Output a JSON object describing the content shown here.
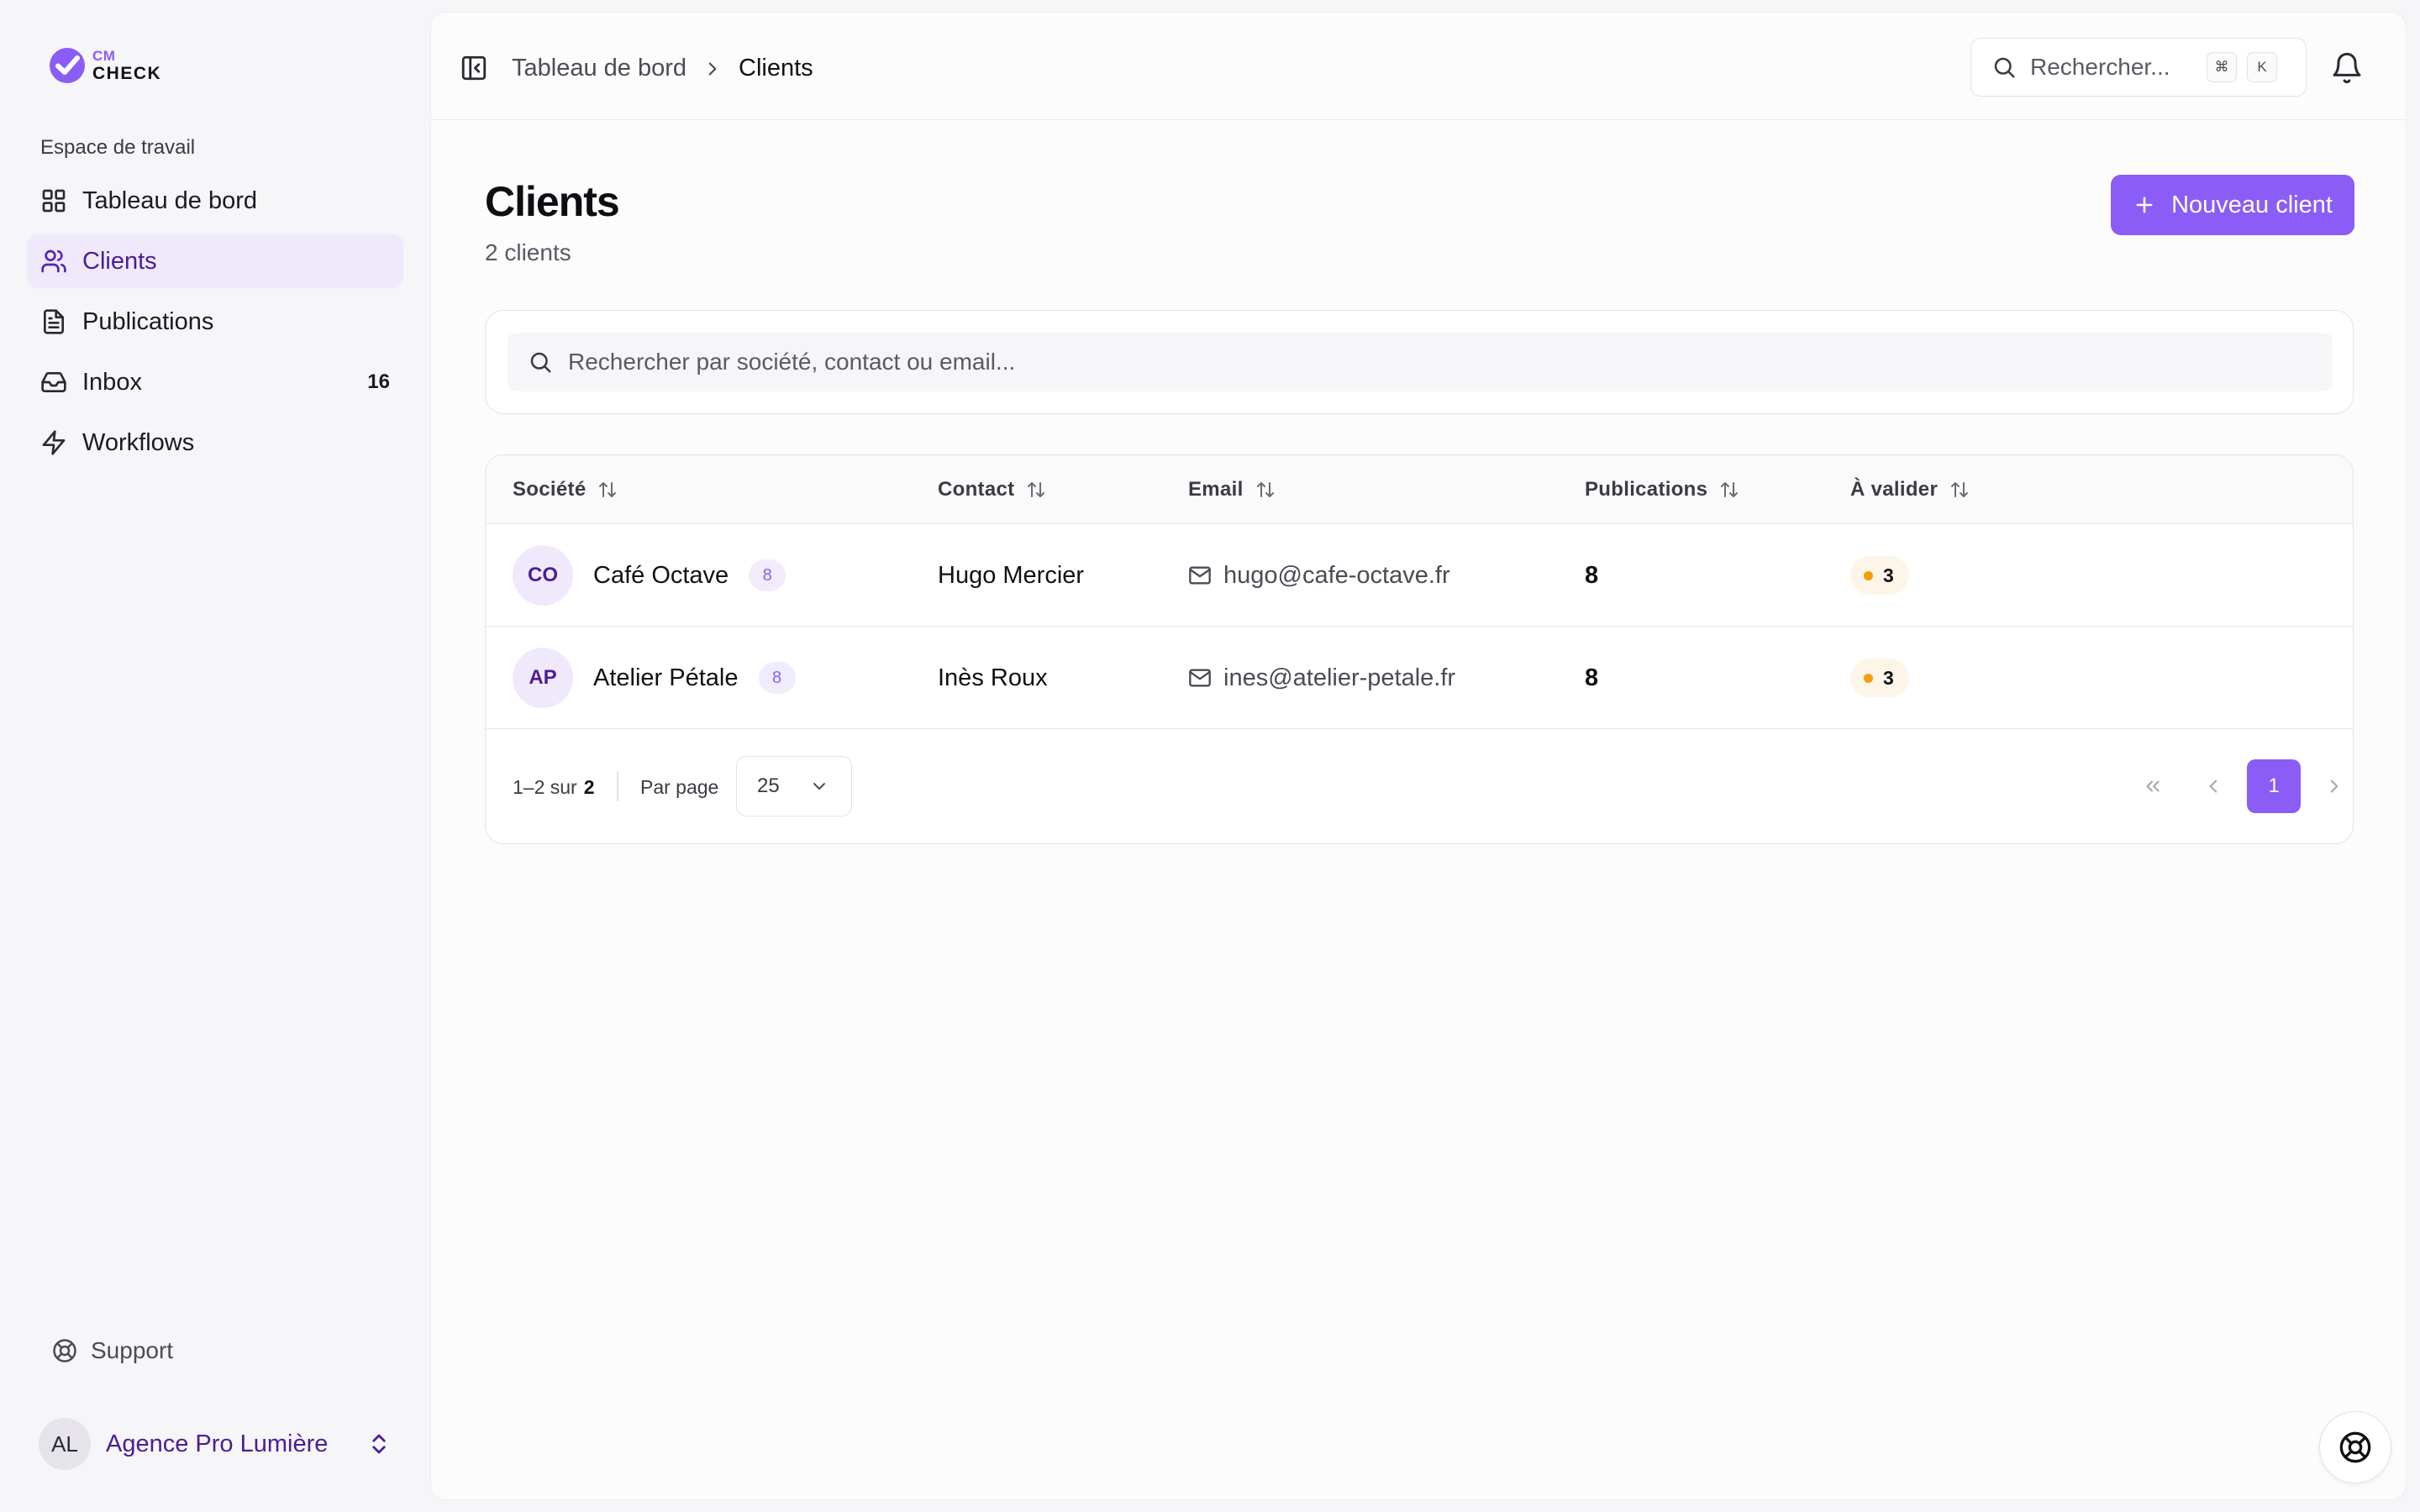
{
  "brand": {
    "logo_top": "CM",
    "logo_bottom": "CHECK",
    "accent_color": "#8b5cf6"
  },
  "sidebar": {
    "section_label": "Espace de travail",
    "items": [
      {
        "label": "Tableau de bord",
        "icon": "layout-grid-icon",
        "active": false
      },
      {
        "label": "Clients",
        "icon": "users-icon",
        "active": true
      },
      {
        "label": "Publications",
        "icon": "file-text-icon",
        "active": false
      },
      {
        "label": "Inbox",
        "icon": "inbox-icon",
        "active": false,
        "badge": "16"
      },
      {
        "label": "Workflows",
        "icon": "zap-icon",
        "active": false
      }
    ],
    "support_label": "Support",
    "account": {
      "initials": "AL",
      "name": "Agence Pro Lumière"
    }
  },
  "topbar": {
    "breadcrumb": [
      "Tableau de bord",
      "Clients"
    ],
    "search_placeholder": "Rechercher...",
    "shortcut_keys": [
      "⌘",
      "K"
    ]
  },
  "page": {
    "title": "Clients",
    "subtitle": "2 clients",
    "new_button_label": "Nouveau client",
    "filter_placeholder": "Rechercher par société, contact ou email..."
  },
  "table": {
    "columns": [
      "Société",
      "Contact",
      "Email",
      "Publications",
      "À valider"
    ],
    "rows": [
      {
        "initials": "CO",
        "company": "Café Octave",
        "company_badge": "8",
        "contact": "Hugo Mercier",
        "email": "hugo@cafe-octave.fr",
        "publications": "8",
        "to_validate": "3"
      },
      {
        "initials": "AP",
        "company": "Atelier Pétale",
        "company_badge": "8",
        "contact": "Inès Roux",
        "email": "ines@atelier-petale.fr",
        "publications": "8",
        "to_validate": "3"
      }
    ],
    "pagination": {
      "range": "1–2 sur",
      "total": "2",
      "per_page_label": "Par page",
      "per_page_value": "25",
      "current_page": "1"
    }
  }
}
